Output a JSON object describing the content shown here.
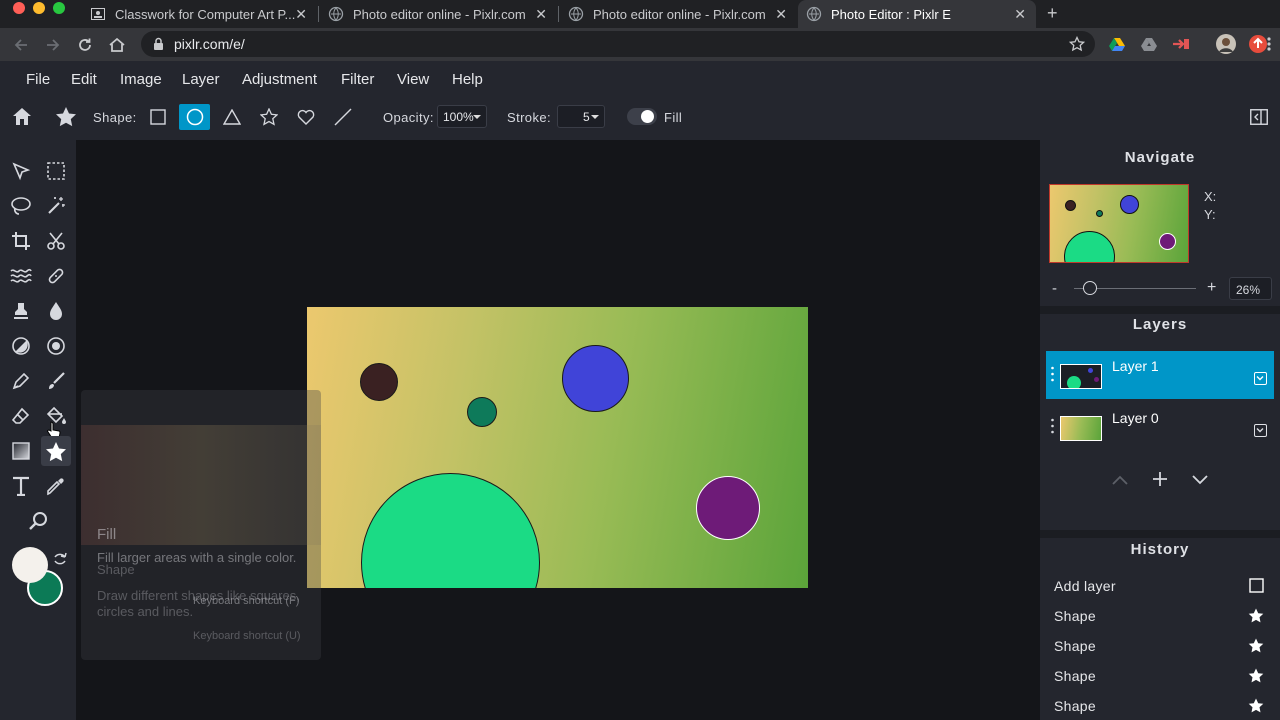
{
  "browser": {
    "tabs": [
      {
        "title": "Classwork for Computer Art P...",
        "active": false
      },
      {
        "title": "Photo editor online - Pixlr.com",
        "active": false
      },
      {
        "title": "Photo editor online - Pixlr.com",
        "active": false
      },
      {
        "title": "Photo Editor : Pixlr E",
        "active": true
      }
    ],
    "close_glyph": "✕",
    "new_tab_glyph": "+",
    "url": "pixlr.com/e/"
  },
  "menu": {
    "items": [
      "File",
      "Edit",
      "Image",
      "Layer",
      "Adjustment",
      "Filter",
      "View",
      "Help"
    ]
  },
  "toolbar": {
    "shape_label": "Shape:",
    "shapes": [
      "rectangle-icon",
      "circle-icon",
      "triangle-icon",
      "star-icon",
      "heart-icon",
      "line-icon"
    ],
    "active_shape": "circle-icon",
    "opacity_label": "Opacity:",
    "opacity_value": "100%",
    "stroke_label": "Stroke:",
    "stroke_value": "5",
    "fill_label": "Fill"
  },
  "tooltip": {
    "title": "Fill",
    "description": "Fill larger areas with a single color.",
    "ghost_title": "Shape",
    "ghost_description": "Draw different shapes like squares, circles and lines.",
    "shortcut": "Keyboard shortcut (F)",
    "ghost_shortcut": "Keyboard shortcut (U)"
  },
  "colors": {
    "accent": "#0096c8",
    "primary_color": "#f4f1ec",
    "secondary_color": "#0c7a56"
  },
  "navigate": {
    "title": "Navigate",
    "x_label": "X:",
    "y_label": "Y:",
    "zoom_minus": "-",
    "zoom_plus": "+",
    "zoom_value": "26%"
  },
  "layers": {
    "title": "Layers",
    "items": [
      {
        "name": "Layer 1",
        "selected": true
      },
      {
        "name": "Layer 0",
        "selected": false
      }
    ]
  },
  "history": {
    "title": "History",
    "items": [
      {
        "label": "Add layer",
        "icon": "square-icon"
      },
      {
        "label": "Shape",
        "icon": "star-icon"
      },
      {
        "label": "Shape",
        "icon": "star-icon"
      },
      {
        "label": "Shape",
        "icon": "star-icon"
      },
      {
        "label": "Shape",
        "icon": "star-icon"
      }
    ]
  }
}
